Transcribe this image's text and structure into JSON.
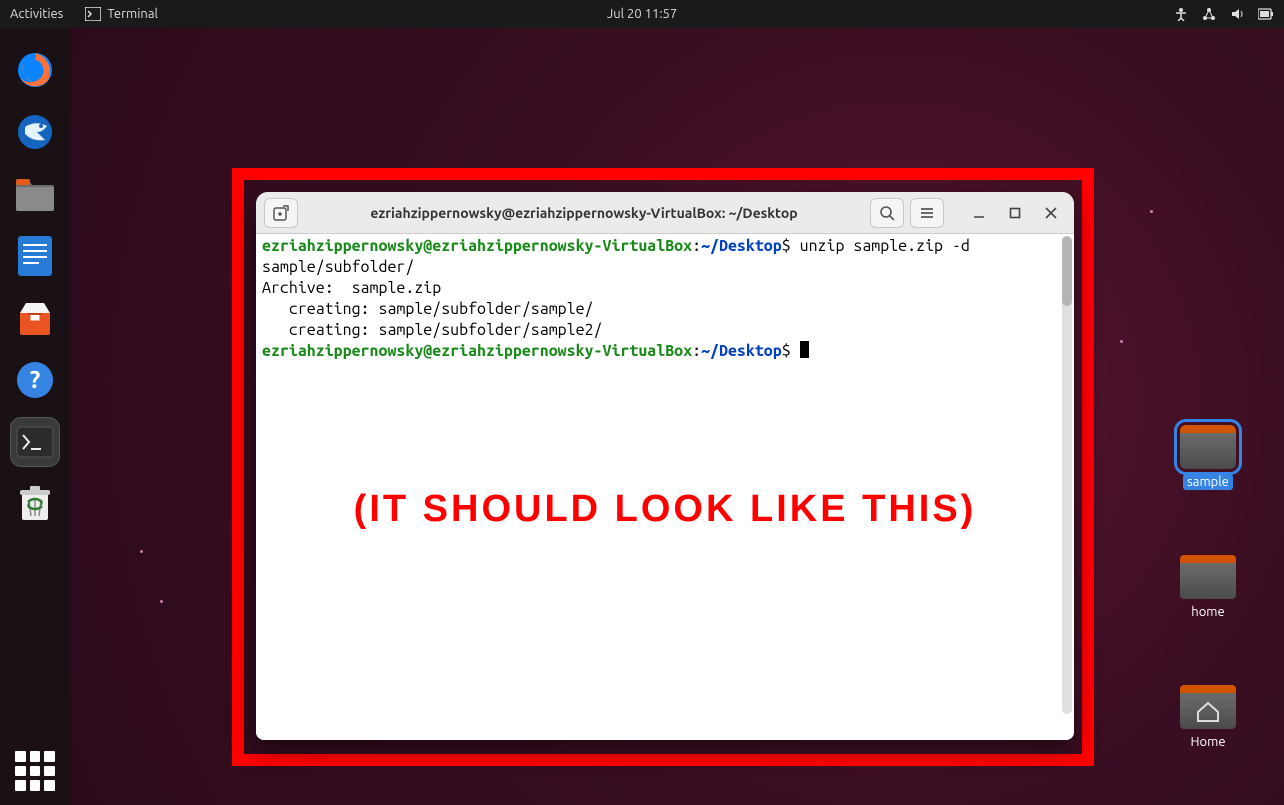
{
  "topbar": {
    "activities": "Activities",
    "app_label": "Terminal",
    "datetime": "Jul 20  11:57"
  },
  "dock": {
    "items": [
      "firefox",
      "thunderbird",
      "files",
      "writer",
      "software",
      "help",
      "terminal",
      "trash"
    ]
  },
  "desktop": {
    "icons": [
      {
        "label": "sample",
        "kind": "folder",
        "selected": true
      },
      {
        "label": "home",
        "kind": "folder",
        "selected": false
      },
      {
        "label": "Home",
        "kind": "home",
        "selected": false
      }
    ]
  },
  "termwin": {
    "title": "ezriahzippernowsky@ezriahzippernowsky-VirtualBox: ~/Desktop",
    "prompt_user": "ezriahzippernowsky@ezriahzippernowsky-VirtualBox",
    "prompt_sep": ":",
    "prompt_path": "~/Desktop",
    "prompt_end": "$ ",
    "cmd1": "unzip sample.zip -d",
    "line2": "sample/subfolder/",
    "line3": "Archive:  sample.zip",
    "line4": "   creating: sample/subfolder/sample/",
    "line5": "   creating: sample/subfolder/sample2/"
  },
  "annotation": {
    "caption": "(IT SHOULD LOOK LIKE THIS)"
  }
}
